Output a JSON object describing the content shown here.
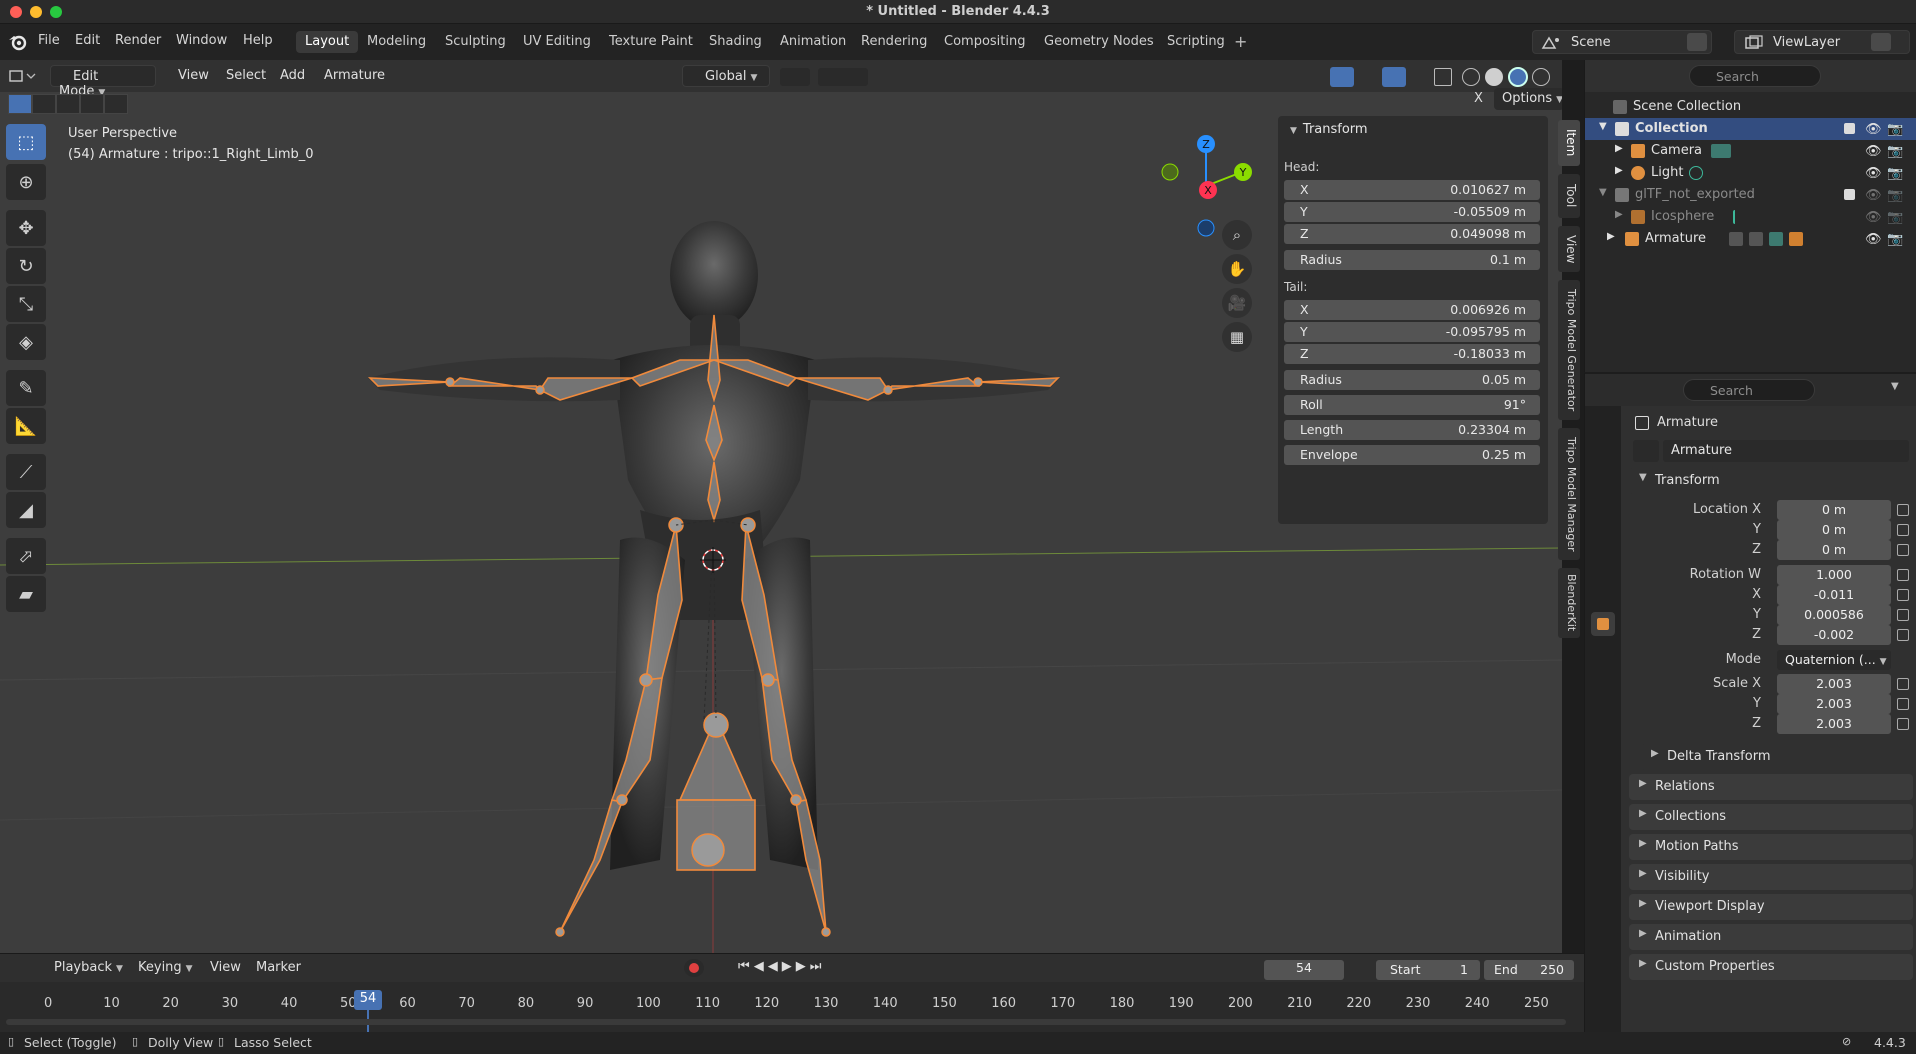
{
  "window": {
    "title": "* Untitled - Blender 4.4.3"
  },
  "menubar": {
    "items": [
      "File",
      "Edit",
      "Render",
      "Window",
      "Help"
    ],
    "workspaces": [
      "Layout",
      "Modeling",
      "Sculpting",
      "UV Editing",
      "Texture Paint",
      "Shading",
      "Animation",
      "Rendering",
      "Compositing",
      "Geometry Nodes",
      "Scripting"
    ],
    "active_workspace": "Layout",
    "scene": "Scene",
    "view_layer": "ViewLayer"
  },
  "viewport": {
    "mode": "Edit Mode",
    "menus": [
      "View",
      "Select",
      "Add",
      "Armature"
    ],
    "orientation": "Global",
    "options_label": "Options",
    "perspective": "User Perspective",
    "active_info": "(54) Armature : tripo::1_Right_Limb_0",
    "gizmo_axes": {
      "x": "X",
      "y": "Y",
      "z": "Z"
    }
  },
  "item_panel": {
    "title": "Transform",
    "head_label": "Head:",
    "tail_label": "Tail:",
    "head": [
      {
        "key": "X",
        "value": "0.010627 m"
      },
      {
        "key": "Y",
        "value": "-0.05509 m"
      },
      {
        "key": "Z",
        "value": "0.049098 m"
      }
    ],
    "head_radius": {
      "key": "Radius",
      "value": "0.1 m"
    },
    "tail": [
      {
        "key": "X",
        "value": "0.006926 m"
      },
      {
        "key": "Y",
        "value": "-0.095795 m"
      },
      {
        "key": "Z",
        "value": "-0.18033 m"
      }
    ],
    "tail_radius": {
      "key": "Radius",
      "value": "0.05 m"
    },
    "roll": {
      "key": "Roll",
      "value": "91°"
    },
    "length": {
      "key": "Length",
      "value": "0.23304 m"
    },
    "envelope": {
      "key": "Envelope",
      "value": "0.25 m"
    },
    "side_tabs": [
      "Item",
      "Tool",
      "View",
      "Tripo Model Generator",
      "Tripo Model Manager",
      "BlenderKit"
    ]
  },
  "outliner": {
    "search_placeholder": "Search",
    "rows": [
      {
        "name": "Scene Collection"
      },
      {
        "name": "Collection"
      },
      {
        "name": "Camera"
      },
      {
        "name": "Light"
      },
      {
        "name": "glTF_not_exported"
      },
      {
        "name": "Icosphere"
      },
      {
        "name": "Armature"
      }
    ]
  },
  "properties": {
    "search_placeholder": "Search",
    "object_name": "Armature",
    "datablock_name": "Armature",
    "transform_label": "Transform",
    "location": {
      "label": "Location X",
      "x": "0 m",
      "y": "0 m",
      "z": "0 m"
    },
    "rotation": {
      "label": "Rotation W",
      "w": "1.000",
      "x": "-0.011",
      "y": "0.000586",
      "z": "-0.002"
    },
    "mode": {
      "label": "Mode",
      "value": "Quaternion (..."
    },
    "scale": {
      "label": "Scale X",
      "x": "2.003",
      "y": "2.003",
      "z": "2.003"
    },
    "axis_labels": {
      "y": "Y",
      "z": "Z",
      "x": "X"
    },
    "subpanels": [
      "Delta Transform",
      "Relations",
      "Collections",
      "Motion Paths",
      "Visibility",
      "Viewport Display",
      "Animation",
      "Custom Properties"
    ]
  },
  "timeline": {
    "menus": [
      "Playback",
      "Keying",
      "View",
      "Marker"
    ],
    "current_frame": "54",
    "start_label": "Start",
    "start": "1",
    "end_label": "End",
    "end": "250",
    "ticks": [
      "0",
      "10",
      "20",
      "30",
      "40",
      "50",
      "60",
      "70",
      "80",
      "90",
      "100",
      "110",
      "120",
      "130",
      "140",
      "150",
      "160",
      "170",
      "180",
      "190",
      "200",
      "210",
      "220",
      "230",
      "240",
      "250"
    ]
  },
  "statusbar": {
    "select": "Select (Toggle)",
    "dolly": "Dolly View",
    "lasso": "Lasso Select",
    "version": "4.4.3"
  },
  "colors": {
    "accent": "#4772b3",
    "bone_outline": "#f08a3c",
    "axis_x": "#ff3352",
    "axis_y": "#8bdc00",
    "axis_z": "#2890ff"
  }
}
